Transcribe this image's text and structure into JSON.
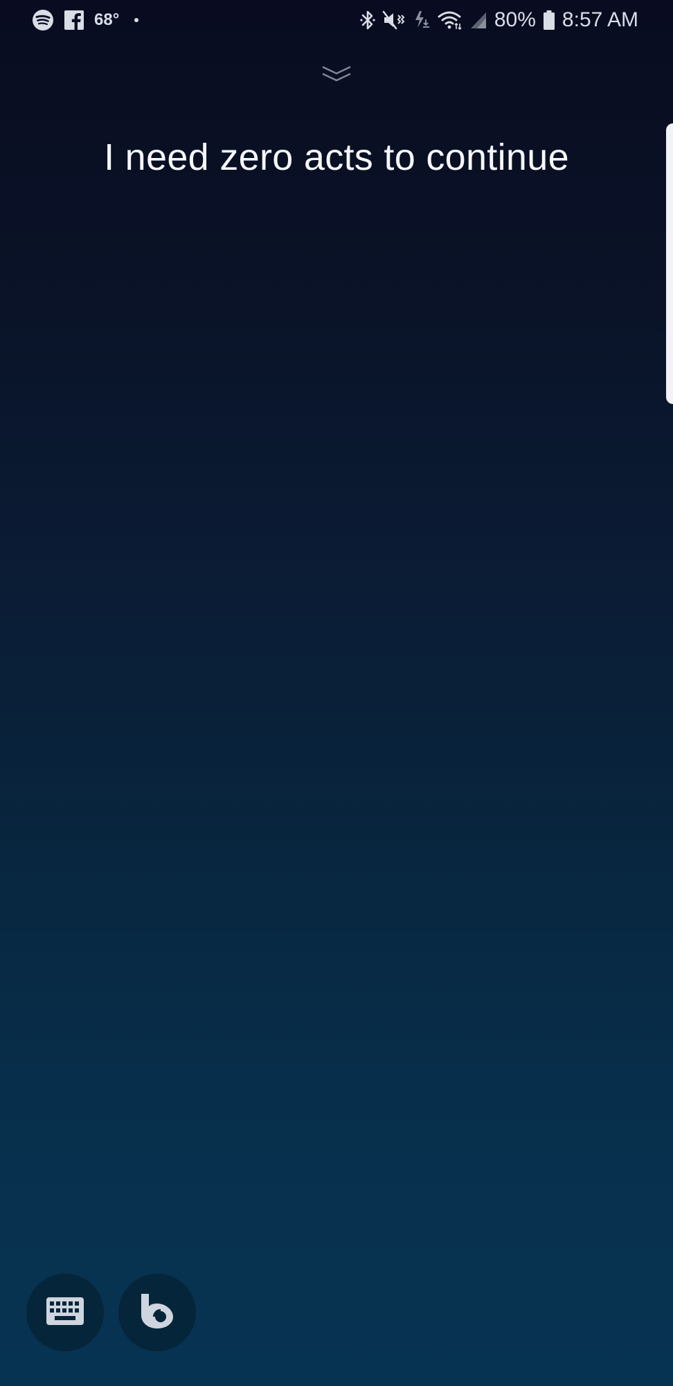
{
  "status_bar": {
    "temperature": "68°",
    "battery_percent": "80%",
    "time": "8:57 AM",
    "left_icons": [
      "spotify-icon",
      "facebook-icon"
    ],
    "right_icons": [
      "bluetooth-icon",
      "mute-vibrate-icon",
      "data-saver-icon",
      "wifi-icon",
      "signal-icon",
      "battery-icon"
    ]
  },
  "assistant": {
    "utterance": "I need zero acts to continue"
  },
  "controls": {
    "collapse_icon": "chevron-double-down-icon",
    "keyboard_icon": "keyboard-icon",
    "bixby_icon": "bixby-icon"
  },
  "colors": {
    "background_top": "#090c20",
    "background_bottom": "#073352",
    "button_fill": "#05253a",
    "text": "#f6f7fa"
  }
}
